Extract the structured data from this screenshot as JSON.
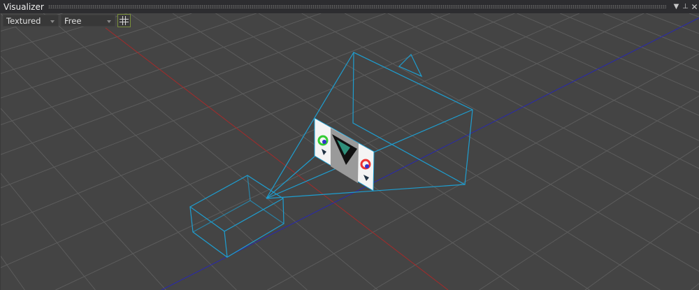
{
  "window": {
    "title": "Visualizer",
    "dropdown_icon": "chevron-down-icon",
    "pin_icon": "pin-icon",
    "close_icon": "close-icon"
  },
  "toolbar": {
    "render_mode": {
      "value": "Textured"
    },
    "camera_mode": {
      "value": "Free"
    },
    "grid_toggle": {
      "icon": "grid-icon",
      "active": true
    }
  },
  "colors": {
    "frustum": "#1e9ed0",
    "grid": "#5c5c5c",
    "x_axis": "#b02a2a",
    "z_axis": "#2a2ab8",
    "background": "#444444",
    "grid_toggle_border": "#7a8f3a"
  }
}
